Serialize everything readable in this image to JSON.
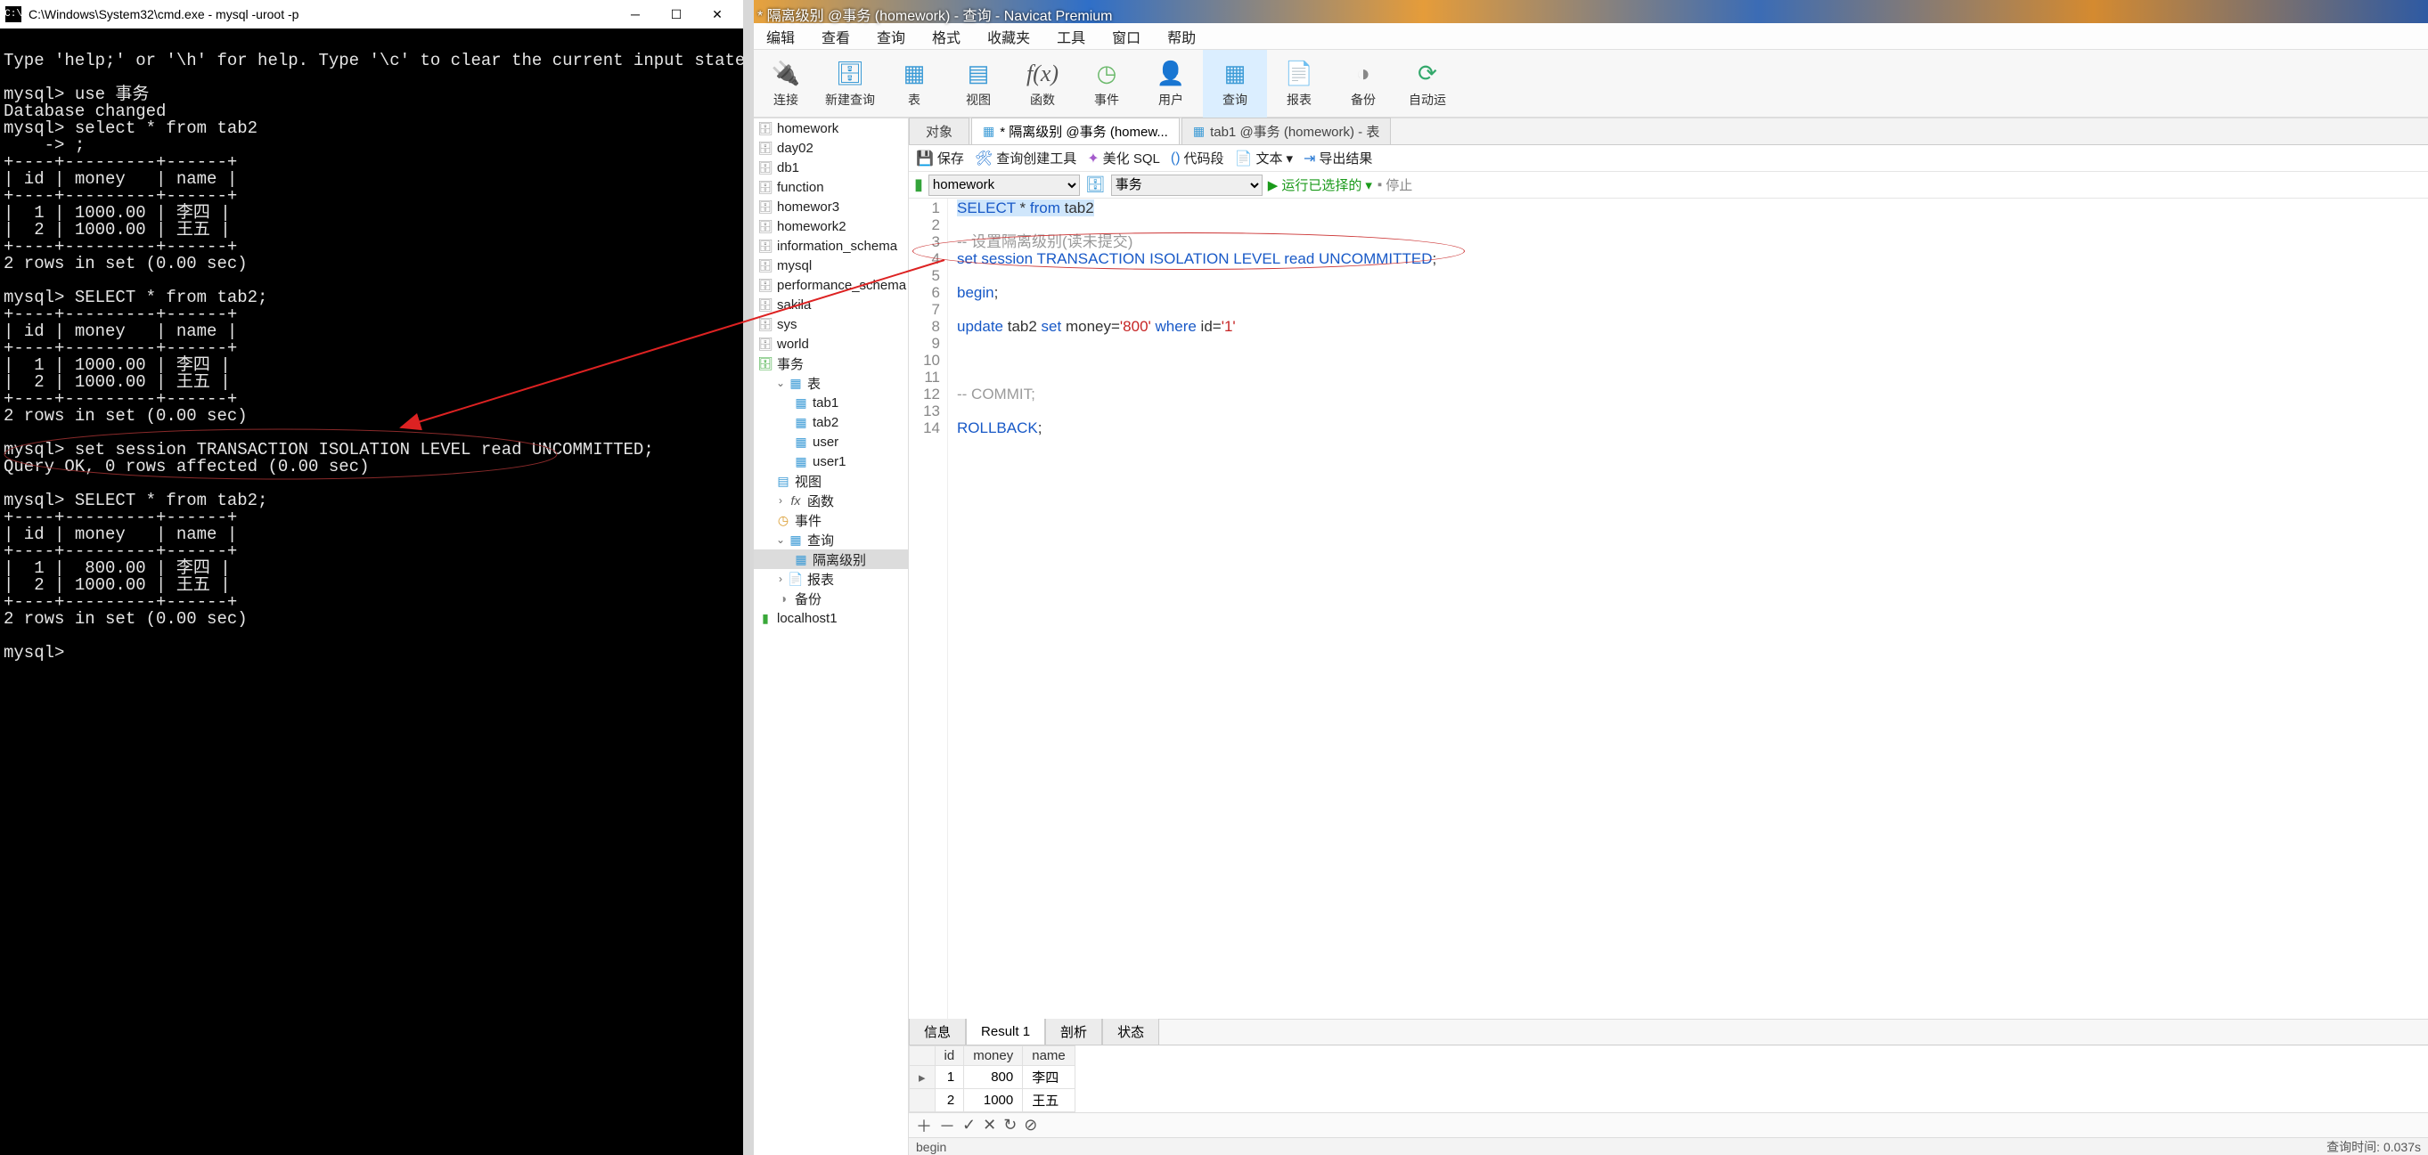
{
  "cmd": {
    "title": "C:\\Windows\\System32\\cmd.exe - mysql  -uroot -p",
    "body": "\nType 'help;' or '\\h' for help. Type '\\c' to clear the current input statement.\n\nmysql> use 事务\nDatabase changed\nmysql> select * from tab2\n    -> ;\n+----+---------+------+\n| id | money   | name |\n+----+---------+------+\n|  1 | 1000.00 | 李四 |\n|  2 | 1000.00 | 王五 |\n+----+---------+------+\n2 rows in set (0.00 sec)\n\nmysql> SELECT * from tab2;\n+----+---------+------+\n| id | money   | name |\n+----+---------+------+\n|  1 | 1000.00 | 李四 |\n|  2 | 1000.00 | 王五 |\n+----+---------+------+\n2 rows in set (0.00 sec)\n\nmysql> set session TRANSACTION ISOLATION LEVEL read UNCOMMITTED;\nQuery OK, 0 rows affected (0.00 sec)\n\nmysql> SELECT * from tab2;\n+----+---------+------+\n| id | money   | name |\n+----+---------+------+\n|  1 |  800.00 | 李四 |\n|  2 | 1000.00 | 王五 |\n+----+---------+------+\n2 rows in set (0.00 sec)\n\nmysql>"
  },
  "navicat": {
    "title": "* 隔离级别 @事务 (homework) - 查询 - Navicat Premium",
    "menu": [
      "编辑",
      "查看",
      "查询",
      "格式",
      "收藏夹",
      "工具",
      "窗口",
      "帮助"
    ],
    "toolbar": [
      {
        "label": "连接",
        "icon": "plug"
      },
      {
        "label": "新建查询",
        "icon": "db-plus"
      },
      {
        "label": "表",
        "icon": "table"
      },
      {
        "label": "视图",
        "icon": "view"
      },
      {
        "label": "函数",
        "icon": "fx"
      },
      {
        "label": "事件",
        "icon": "clock"
      },
      {
        "label": "用户",
        "icon": "user"
      },
      {
        "label": "查询",
        "icon": "query",
        "active": true
      },
      {
        "label": "报表",
        "icon": "report"
      },
      {
        "label": "备份",
        "icon": "backup"
      },
      {
        "label": "自动运",
        "icon": "auto"
      }
    ],
    "tree": {
      "databases": [
        "homework",
        "day02",
        "db1",
        "function",
        "homewor3",
        "homework2",
        "information_schema",
        "mysql",
        "performance_schema",
        "sakila",
        "sys",
        "world",
        "事务"
      ],
      "open_db": "事务",
      "tables": [
        "tab1",
        "tab2",
        "user",
        "user1"
      ],
      "sections": {
        "view": "视图",
        "fx": "函数",
        "event": "事件",
        "query": "查询",
        "report": "报表",
        "backup": "备份"
      },
      "queries": [
        "隔离级别"
      ],
      "connection": "localhost1"
    },
    "tabs": {
      "object": "对象",
      "t1": "* 隔离级别 @事务 (homew...",
      "t2": "tab1 @事务 (homework) - 表"
    },
    "subbar": {
      "save": "保存",
      "builder": "查询创建工具",
      "beautify": "美化 SQL",
      "snippet": "代码段",
      "text": "文本",
      "export": "导出结果"
    },
    "runbar": {
      "db": "homework",
      "schema": "事务",
      "run": "运行已选择的",
      "stop": "停止"
    },
    "code": {
      "lines": [
        {
          "n": 1,
          "html": "<span class='sel-bg'><span class='kw'>SELECT</span> * <span class='kw'>from</span> tab2</span>"
        },
        {
          "n": 2,
          "html": ""
        },
        {
          "n": 3,
          "html": "<span class='cm'>-- 设置隔离级别(读未提交)</span>"
        },
        {
          "n": 4,
          "html": "<span class='kw'>set</span> <span class='kw'>session</span> <span class='kw'>TRANSACTION</span> <span class='kw'>ISOLATION</span> <span class='kw'>LEVEL</span> <span class='kw'>read</span> <span class='kw'>UNCOMMITTED</span>;"
        },
        {
          "n": 5,
          "html": ""
        },
        {
          "n": 6,
          "html": "<span class='kw'>begin</span>;"
        },
        {
          "n": 7,
          "html": ""
        },
        {
          "n": 8,
          "html": "<span class='kw'>update</span> tab2 <span class='kw'>set</span> money=<span class='str'>'800'</span> <span class='kw'>where</span> id=<span class='str'>'1'</span>"
        },
        {
          "n": 9,
          "html": ""
        },
        {
          "n": 10,
          "html": ""
        },
        {
          "n": 11,
          "html": ""
        },
        {
          "n": 12,
          "html": "<span class='cm'>-- COMMIT;</span>"
        },
        {
          "n": 13,
          "html": ""
        },
        {
          "n": 14,
          "html": "<span class='kw'>ROLLBACK</span>;"
        }
      ]
    },
    "restabs": [
      "信息",
      "Result 1",
      "剖析",
      "状态"
    ],
    "result": {
      "cols": [
        "id",
        "money",
        "name"
      ],
      "rows": [
        {
          "id": 1,
          "money": 800,
          "name": "李四"
        },
        {
          "id": 2,
          "money": 1000,
          "name": "王五"
        }
      ]
    },
    "gridbar": [
      "＋",
      "－",
      "✓",
      "✕",
      "↻",
      "⊘"
    ],
    "status": {
      "left": "begin",
      "right": "查询时间: 0.037s"
    }
  }
}
